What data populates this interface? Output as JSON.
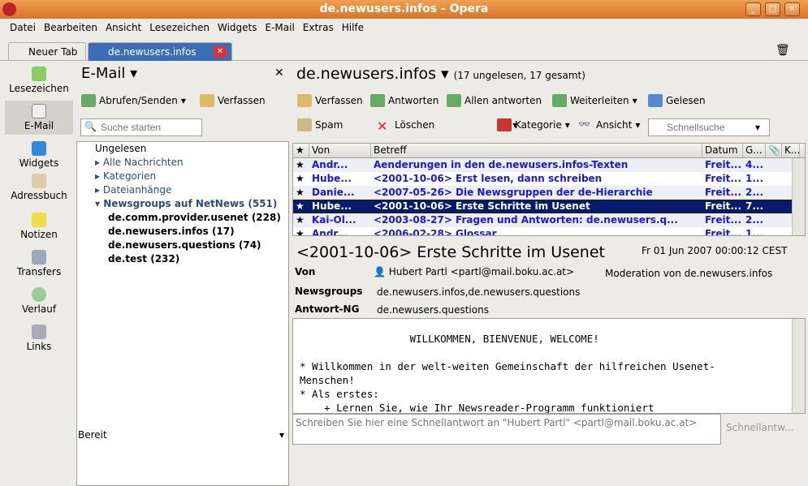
{
  "window": {
    "title": "de.newusers.infos - Opera"
  },
  "menu": [
    "Datei",
    "Bearbeiten",
    "Ansicht",
    "Lesezeichen",
    "Widgets",
    "E-Mail",
    "Extras",
    "Hilfe"
  ],
  "tabs": [
    {
      "label": "Neuer Tab"
    },
    {
      "label": "de.newusers.infos"
    }
  ],
  "sidebar": [
    "Lesezeichen",
    "E-Mail",
    "Widgets",
    "Adressbuch",
    "Notizen",
    "Transfers",
    "Verlauf",
    "Links"
  ],
  "email": {
    "title": "E-Mail",
    "fetch": "Abrufen/Senden",
    "compose": "Verfassen",
    "search_placeholder": "Suche starten",
    "tree": {
      "unread": "Ungelesen",
      "all": "Alle Nachrichten",
      "cats": "Kategorien",
      "attach": "Dateianhänge",
      "groups": "Newsgroups auf NetNews (551)",
      "items": [
        "de.comm.provider.usenet (228)",
        "de.newusers.infos (17)",
        "de.newusers.questions (74)",
        "de.test (232)"
      ]
    },
    "status": "Bereit"
  },
  "main": {
    "title": "de.newusers.infos",
    "counts": "(17 ungelesen, 17 gesamt)",
    "toolbar": {
      "compose": "Verfassen",
      "reply": "Antworten",
      "reply_all": "Allen antworten",
      "forward": "Weiterleiten",
      "read": "Gelesen",
      "spam": "Spam",
      "delete": "Löschen",
      "label": "Kategorie",
      "view": "Ansicht",
      "quicksearch": "Schnellsuche"
    },
    "columns": [
      "★",
      "Von",
      "Betreff",
      "Datum",
      "G...",
      "📎",
      "K..."
    ],
    "messages": [
      {
        "from": "Andr...",
        "subject": "Aenderungen in den de.newusers.infos-Texten",
        "date": "Freit...",
        "size": "4..."
      },
      {
        "from": "Hube...",
        "subject": "<2001-10-06> Erst lesen, dann schreiben",
        "date": "Freit...",
        "size": "1..."
      },
      {
        "from": "Danie...",
        "subject": "<2007-05-26> Die Newsgruppen der de-Hierarchie",
        "date": "Freit...",
        "size": "2..."
      },
      {
        "from": "Hube...",
        "subject": "<2001-10-06> Erste Schritte im Usenet",
        "date": "Freit...",
        "size": "7..."
      },
      {
        "from": "Kai-Ol...",
        "subject": "<2003-08-27> Fragen und Antworten: de.newusers.q...",
        "date": "Freit...",
        "size": "2..."
      },
      {
        "from": "Andr...",
        "subject": "<2006-02-28> Glossar",
        "date": "Freit...",
        "size": "1..."
      }
    ],
    "msg": {
      "subject": "<2001-10-06> Erste Schritte im Usenet",
      "date": "Fr 01 Jun 2007 00:00:12 CEST",
      "from_label": "Von",
      "from": "Hubert Partl <partl@mail.boku.ac.at>",
      "moderation": "Moderation von de.newusers.infos",
      "ng_label": "Newsgroups",
      "ng": "de.newusers.infos,de.newusers.questions",
      "fu_label": "Antwort-NG",
      "fu": "de.newusers.questions",
      "body": "                  WILLKOMMEN, BIENVENUE, WELCOME!\n\n* Willkommen in der welt-weiten Gemeinschaft der hilfreichen Usenet-\nMenschen!\n* Als erstes:\n    + Lernen Sie, wie Ihr Newsreader-Programm funktioniert"
    },
    "quick_reply_placeholder": "Schreiben Sie hier eine Schnellantwort an \"Hubert Partl\" <partl@mail.boku.ac.at>",
    "quick_reply_button": "Schnellantw..."
  }
}
